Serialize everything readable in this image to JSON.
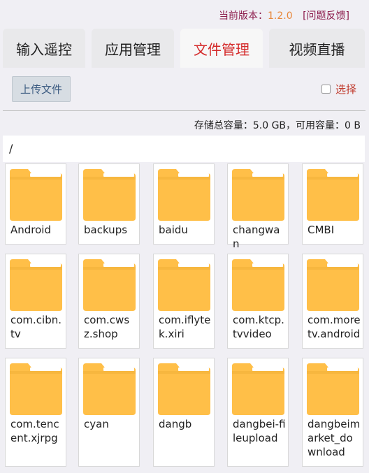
{
  "header": {
    "version_label": "当前版本：",
    "version_value": "1.2.0",
    "feedback_label": "[问题反馈]"
  },
  "tabs": [
    {
      "label": "输入遥控",
      "active": false
    },
    {
      "label": "应用管理",
      "active": false
    },
    {
      "label": "文件管理",
      "active": true
    },
    {
      "label": "视频直播",
      "active": false
    }
  ],
  "toolbar": {
    "upload_label": "上传文件",
    "select_label": "选择",
    "select_checked": false
  },
  "storage": {
    "text": "存储总容量：5.0 GB，可用容量：0 B"
  },
  "path": "/",
  "folders": [
    {
      "name": "Android"
    },
    {
      "name": "backups"
    },
    {
      "name": "baidu"
    },
    {
      "name": "changwan"
    },
    {
      "name": "CMBI"
    },
    {
      "name": "com.cibn.tv"
    },
    {
      "name": "com.cwsz.shop"
    },
    {
      "name": "com.iflytek.xiri"
    },
    {
      "name": "com.ktcp.tvvideo"
    },
    {
      "name": "com.moretv.android"
    },
    {
      "name": "com.tencent.xjrpg"
    },
    {
      "name": "cyan"
    },
    {
      "name": "dangb"
    },
    {
      "name": "dangbei-fileupload"
    },
    {
      "name": "dangbeimarket_download"
    }
  ],
  "colors": {
    "accent": "#d42a2a",
    "folder_body": "#ffbf48",
    "folder_tab": "#e8a830",
    "version": "#e8873a"
  }
}
